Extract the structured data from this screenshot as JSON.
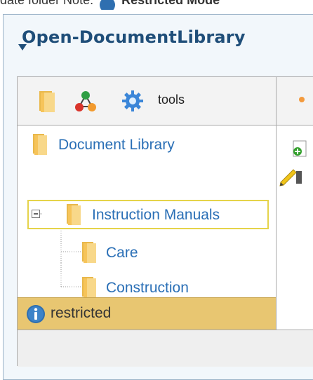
{
  "top_line": {
    "text": "date folder Note: ",
    "restricted_text": "Restricted Mode"
  },
  "panel": {
    "title": "Open-DocumentLibrary"
  },
  "toolbar": {
    "tools_label": "tools"
  },
  "tree": {
    "root": "Document Library",
    "selected": "Instruction Manuals",
    "children": [
      "Care",
      "Construction"
    ]
  },
  "status": {
    "text": "restricted"
  },
  "colors": {
    "title": "#1f4e79",
    "link": "#2a6fb6",
    "status_bg": "#e8c671",
    "selection_border": "#e5d34a"
  }
}
